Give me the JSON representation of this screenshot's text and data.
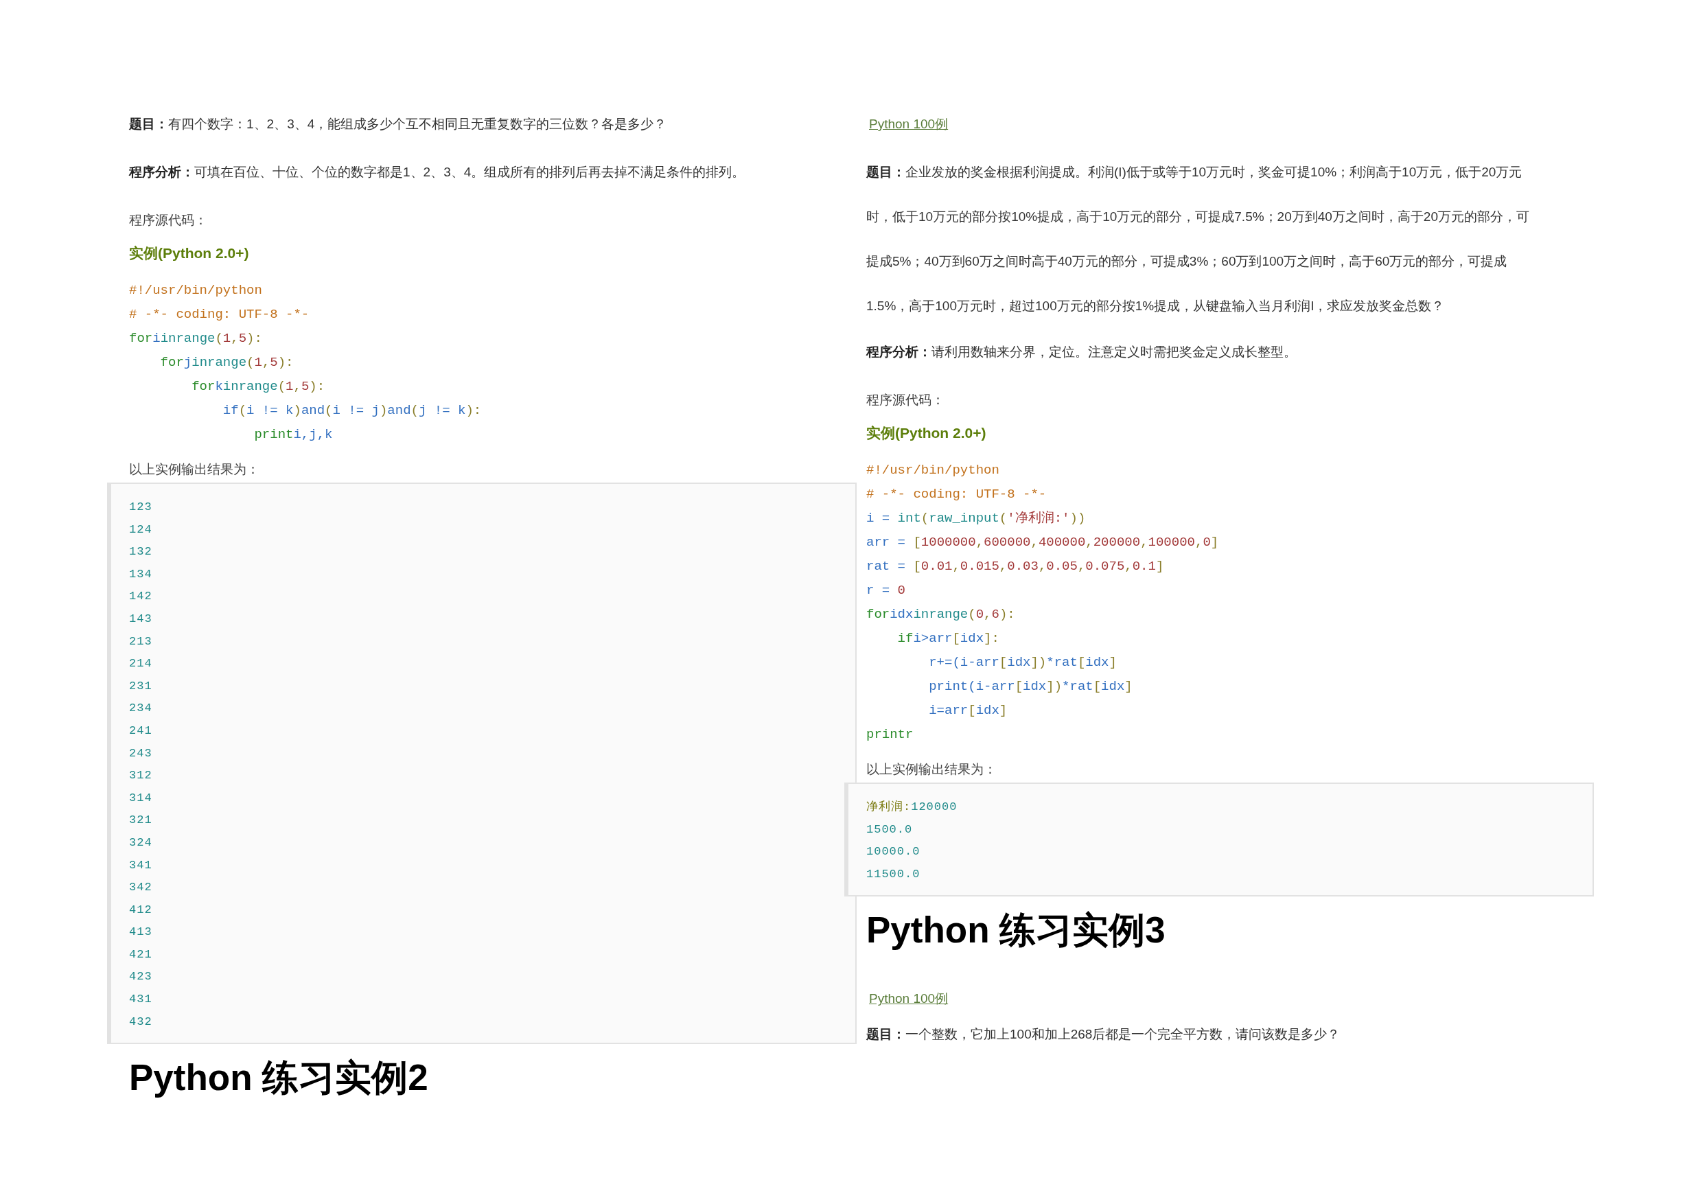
{
  "columns": [
    {
      "blocks": [
        {
          "kind": "paragraph",
          "text": "**题目：**有四个数字：1、2、3、4，能组成多少个互不相同且无重复数字的三位数？各是多少？"
        },
        {
          "kind": "paragraph",
          "text": "**程序分析：**可填在百位、十位、个位的数字都是1、2、3、4。组成所有的排列后再去掉不满足条件的排列。"
        },
        {
          "kind": "plain",
          "text": "程序源代码："
        },
        {
          "kind": "example_title",
          "text": "实例(Python 2.0+)"
        },
        {
          "kind": "code",
          "lines": [
            [
              {
                "kind": "comment",
                "text": "#!/usr/bin/python"
              }
            ],
            [
              {
                "kind": "comment",
                "text": "# -*- coding: UTF-8 -*-"
              }
            ],
            [
              {
                "kind": "keyword",
                "text": "for"
              },
              {
                "kind": "name",
                "text": "i"
              },
              {
                "kind": "builtin",
                "text": "inrange"
              },
              {
                "kind": "punct",
                "text": "("
              },
              {
                "kind": "number",
                "text": "1"
              },
              {
                "kind": "punct",
                "text": ","
              },
              {
                "kind": "number",
                "text": "5"
              },
              {
                "kind": "punct",
                "text": "):"
              }
            ],
            [
              {
                "kind": "keyword",
                "text": "    for"
              },
              {
                "kind": "name",
                "text": "j"
              },
              {
                "kind": "builtin",
                "text": "inrange"
              },
              {
                "kind": "punct",
                "text": "("
              },
              {
                "kind": "number",
                "text": "1"
              },
              {
                "kind": "punct",
                "text": ","
              },
              {
                "kind": "number",
                "text": "5"
              },
              {
                "kind": "punct",
                "text": "):"
              }
            ],
            [
              {
                "kind": "keyword",
                "text": "        for"
              },
              {
                "kind": "name",
                "text": "k"
              },
              {
                "kind": "builtin",
                "text": "inrange"
              },
              {
                "kind": "punct",
                "text": "("
              },
              {
                "kind": "number",
                "text": "1"
              },
              {
                "kind": "punct",
                "text": ","
              },
              {
                "kind": "number",
                "text": "5"
              },
              {
                "kind": "punct",
                "text": "):"
              }
            ],
            [
              {
                "kind": "name",
                "text": "            if"
              },
              {
                "kind": "punct",
                "text": "("
              },
              {
                "kind": "name",
                "text": "i != k"
              },
              {
                "kind": "punct",
                "text": ")"
              },
              {
                "kind": "name",
                "text": "and"
              },
              {
                "kind": "punct",
                "text": "("
              },
              {
                "kind": "name",
                "text": "i != j"
              },
              {
                "kind": "punct",
                "text": ")"
              },
              {
                "kind": "name",
                "text": "and"
              },
              {
                "kind": "punct",
                "text": "("
              },
              {
                "kind": "name",
                "text": "j != k"
              },
              {
                "kind": "punct",
                "text": "):"
              }
            ],
            [
              {
                "kind": "keyword",
                "text": "                print"
              },
              {
                "kind": "name",
                "text": "i,j,k"
              }
            ]
          ]
        },
        {
          "kind": "plain",
          "text": "以上实例输出结果为："
        },
        {
          "kind": "output",
          "lines": [
            [
              {
                "kind": "builtin",
                "text": "123"
              }
            ],
            [
              {
                "kind": "builtin",
                "text": "124"
              }
            ],
            [
              {
                "kind": "builtin",
                "text": "132"
              }
            ],
            [
              {
                "kind": "builtin",
                "text": "134"
              }
            ],
            [
              {
                "kind": "builtin",
                "text": "142"
              }
            ],
            [
              {
                "kind": "builtin",
                "text": "143"
              }
            ],
            [
              {
                "kind": "builtin",
                "text": "213"
              }
            ],
            [
              {
                "kind": "builtin",
                "text": "214"
              }
            ],
            [
              {
                "kind": "builtin",
                "text": "231"
              }
            ],
            [
              {
                "kind": "builtin",
                "text": "234"
              }
            ],
            [
              {
                "kind": "builtin",
                "text": "241"
              }
            ],
            [
              {
                "kind": "builtin",
                "text": "243"
              }
            ],
            [
              {
                "kind": "builtin",
                "text": "312"
              }
            ],
            [
              {
                "kind": "builtin",
                "text": "314"
              }
            ],
            [
              {
                "kind": "builtin",
                "text": "321"
              }
            ],
            [
              {
                "kind": "builtin",
                "text": "324"
              }
            ],
            [
              {
                "kind": "builtin",
                "text": "341"
              }
            ],
            [
              {
                "kind": "builtin",
                "text": "342"
              }
            ],
            [
              {
                "kind": "builtin",
                "text": "412"
              }
            ],
            [
              {
                "kind": "builtin",
                "text": "413"
              }
            ],
            [
              {
                "kind": "builtin",
                "text": "421"
              }
            ],
            [
              {
                "kind": "builtin",
                "text": "423"
              }
            ],
            [
              {
                "kind": "builtin",
                "text": "431"
              }
            ],
            [
              {
                "kind": "builtin",
                "text": "432"
              }
            ]
          ]
        },
        {
          "kind": "heading",
          "text": "Python 练习实例2"
        }
      ]
    },
    {
      "blocks": [
        {
          "kind": "link",
          "text": "Python 100例"
        },
        {
          "kind": "long_paragraph",
          "text": "**题目：**企业发放的奖金根据利润提成。利润(I)低于或等于10万元时，奖金可提10%；利润高于10万元，低于20万元时，低于10万元的部分按10%提成，高于10万元的部分，可提成7.5%；20万到40万之间时，高于20万元的部分，可提成5%；40万到60万之间时高于40万元的部分，可提成3%；60万到100万之间时，高于60万元的部分，可提成1.5%，高于100万元时，超过100万元的部分按1%提成，从键盘输入当月利润I，求应发放奖金总数？"
        },
        {
          "kind": "paragraph",
          "text": "**程序分析：**请利用数轴来分界，定位。注意定义时需把奖金定义成长整型。"
        },
        {
          "kind": "plain",
          "text": "程序源代码："
        },
        {
          "kind": "example_title",
          "text": "实例(Python 2.0+)"
        },
        {
          "kind": "code",
          "lines": [
            [
              {
                "kind": "comment",
                "text": "#!/usr/bin/python"
              }
            ],
            [
              {
                "kind": "comment",
                "text": "# -*- coding: UTF-8 -*-"
              }
            ],
            [
              {
                "kind": "name",
                "text": "i = "
              },
              {
                "kind": "builtin",
                "text": "int"
              },
              {
                "kind": "punct",
                "text": "("
              },
              {
                "kind": "builtin",
                "text": "raw_input"
              },
              {
                "kind": "punct",
                "text": "("
              },
              {
                "kind": "number",
                "text": "'净利润:'"
              },
              {
                "kind": "punct",
                "text": "))"
              }
            ],
            [
              {
                "kind": "name",
                "text": "arr = "
              },
              {
                "kind": "punct",
                "text": "["
              },
              {
                "kind": "number",
                "text": "1000000"
              },
              {
                "kind": "punct",
                "text": ","
              },
              {
                "kind": "number",
                "text": "600000"
              },
              {
                "kind": "punct",
                "text": ","
              },
              {
                "kind": "number",
                "text": "400000"
              },
              {
                "kind": "punct",
                "text": ","
              },
              {
                "kind": "number",
                "text": "200000"
              },
              {
                "kind": "punct",
                "text": ","
              },
              {
                "kind": "number",
                "text": "100000"
              },
              {
                "kind": "punct",
                "text": ","
              },
              {
                "kind": "number",
                "text": "0"
              },
              {
                "kind": "punct",
                "text": "]"
              }
            ],
            [
              {
                "kind": "name",
                "text": "rat = "
              },
              {
                "kind": "punct",
                "text": "["
              },
              {
                "kind": "number",
                "text": "0.01"
              },
              {
                "kind": "punct",
                "text": ","
              },
              {
                "kind": "number",
                "text": "0.015"
              },
              {
                "kind": "punct",
                "text": ","
              },
              {
                "kind": "number",
                "text": "0.03"
              },
              {
                "kind": "punct",
                "text": ","
              },
              {
                "kind": "number",
                "text": "0.05"
              },
              {
                "kind": "punct",
                "text": ","
              },
              {
                "kind": "number",
                "text": "0.075"
              },
              {
                "kind": "punct",
                "text": ","
              },
              {
                "kind": "number",
                "text": "0.1"
              },
              {
                "kind": "punct",
                "text": "]"
              }
            ],
            [
              {
                "kind": "name",
                "text": "r = "
              },
              {
                "kind": "number",
                "text": "0"
              }
            ],
            [
              {
                "kind": "keyword",
                "text": "for"
              },
              {
                "kind": "name",
                "text": "idx"
              },
              {
                "kind": "builtin",
                "text": "inrange"
              },
              {
                "kind": "punct",
                "text": "("
              },
              {
                "kind": "number",
                "text": "0"
              },
              {
                "kind": "punct",
                "text": ","
              },
              {
                "kind": "number",
                "text": "6"
              },
              {
                "kind": "punct",
                "text": "):"
              }
            ],
            [
              {
                "kind": "keyword",
                "text": "    if"
              },
              {
                "kind": "name",
                "text": "i>arr"
              },
              {
                "kind": "punct",
                "text": "["
              },
              {
                "kind": "name",
                "text": "idx"
              },
              {
                "kind": "punct",
                "text": "]:"
              }
            ],
            [
              {
                "kind": "name",
                "text": "        r+=(i-arr"
              },
              {
                "kind": "punct",
                "text": "["
              },
              {
                "kind": "name",
                "text": "idx"
              },
              {
                "kind": "punct",
                "text": "])"
              },
              {
                "kind": "name",
                "text": "*rat"
              },
              {
                "kind": "punct",
                "text": "["
              },
              {
                "kind": "name",
                "text": "idx"
              },
              {
                "kind": "punct",
                "text": "]"
              }
            ],
            [
              {
                "kind": "name",
                "text": "        print(i-arr"
              },
              {
                "kind": "punct",
                "text": "["
              },
              {
                "kind": "name",
                "text": "idx"
              },
              {
                "kind": "punct",
                "text": "])"
              },
              {
                "kind": "name",
                "text": "*rat"
              },
              {
                "kind": "punct",
                "text": "["
              },
              {
                "kind": "name",
                "text": "idx"
              },
              {
                "kind": "punct",
                "text": "]"
              }
            ],
            [
              {
                "kind": "name",
                "text": "        i=arr"
              },
              {
                "kind": "punct",
                "text": "["
              },
              {
                "kind": "name",
                "text": "idx"
              },
              {
                "kind": "punct",
                "text": "]"
              }
            ],
            [
              {
                "kind": "keyword",
                "text": "printr"
              }
            ]
          ]
        },
        {
          "kind": "plain",
          "text": "以上实例输出结果为："
        },
        {
          "kind": "output",
          "lines": [
            [
              {
                "kind": "prompt",
                "text": "净利润:"
              },
              {
                "kind": "builtin",
                "text": "120000"
              }
            ],
            [
              {
                "kind": "builtin",
                "text": "1500.0"
              }
            ],
            [
              {
                "kind": "builtin",
                "text": "10000.0"
              }
            ],
            [
              {
                "kind": "builtin",
                "text": "11500.0"
              }
            ]
          ]
        },
        {
          "kind": "heading",
          "text": "Python 练习实例3"
        },
        {
          "kind": "link",
          "text": "Python 100例"
        },
        {
          "kind": "paragraph",
          "text": "**题目：**一个整数，它加上100和加上268后都是一个完全平方数，请问该数是多少？"
        }
      ]
    }
  ]
}
